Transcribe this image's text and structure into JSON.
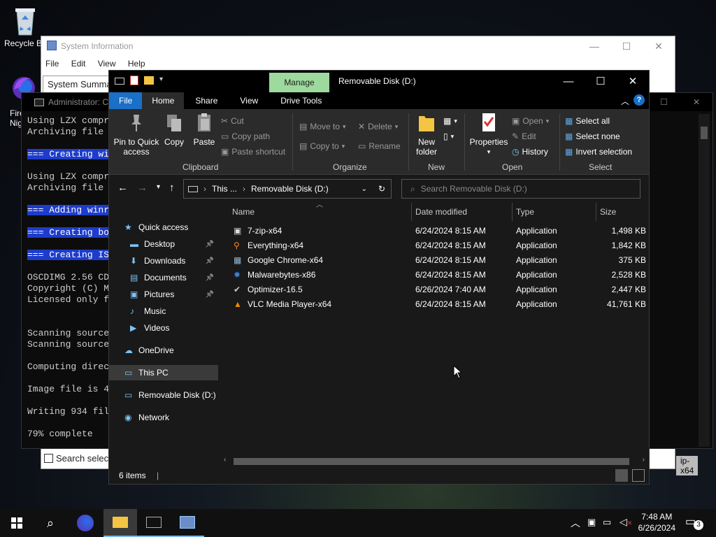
{
  "desktop": {
    "recycle_bin_label": "Recycle B",
    "firefox_label_line1": "Fire",
    "firefox_label_line2": "Nig",
    "side_label": "ip-x64"
  },
  "sysinfo": {
    "title": "System Information",
    "menu": [
      "File",
      "Edit",
      "View",
      "Help"
    ],
    "left_item": "System Summa",
    "search_label": "Search select"
  },
  "console": {
    "title": "Administrator: C",
    "lines": [
      {
        "text": "Using LZX compr",
        "highlight": false
      },
      {
        "text": "Archiving file",
        "highlight": false
      },
      {
        "text": "",
        "highlight": false
      },
      {
        "text": "=== Creating wi",
        "highlight": true
      },
      {
        "text": "",
        "highlight": false
      },
      {
        "text": "Using LZX compr",
        "highlight": false
      },
      {
        "text": "Archiving file",
        "highlight": false
      },
      {
        "text": "",
        "highlight": false
      },
      {
        "text": "=== Adding winr",
        "highlight": true
      },
      {
        "text": "",
        "highlight": false
      },
      {
        "text": "=== Creating bo",
        "highlight": true
      },
      {
        "text": "",
        "highlight": false
      },
      {
        "text": "=== Creating IS",
        "highlight": true
      },
      {
        "text": "",
        "highlight": false
      },
      {
        "text": "OSCDIMG 2.56 CD",
        "highlight": false
      },
      {
        "text": "Copyright (C) M",
        "highlight": false
      },
      {
        "text": "Licensed only f",
        "highlight": false
      },
      {
        "text": "",
        "highlight": false
      },
      {
        "text": "",
        "highlight": false
      },
      {
        "text": "Scanning source",
        "highlight": false
      },
      {
        "text": "Scanning source",
        "highlight": false
      },
      {
        "text": "",
        "highlight": false
      },
      {
        "text": "Computing direc",
        "highlight": false
      },
      {
        "text": "",
        "highlight": false
      },
      {
        "text": "Image file is 4",
        "highlight": false
      },
      {
        "text": "",
        "highlight": false
      },
      {
        "text": "Writing 934 fil",
        "highlight": false
      },
      {
        "text": "",
        "highlight": false
      },
      {
        "text": "79% complete",
        "highlight": false
      }
    ]
  },
  "explorer": {
    "title": "Removable Disk (D:)",
    "manage_tab": "Manage",
    "tabs": [
      "File",
      "Home",
      "Share",
      "View",
      "Drive Tools"
    ],
    "ribbon": {
      "pin": "Pin to Quick\naccess",
      "copy": "Copy",
      "paste": "Paste",
      "cut": "Cut",
      "copy_path": "Copy path",
      "paste_shortcut": "Paste shortcut",
      "clipboard": "Clipboard",
      "move_to": "Move to",
      "copy_to": "Copy to",
      "delete": "Delete",
      "rename": "Rename",
      "organize": "Organize",
      "new_folder": "New\nfolder",
      "new": "New",
      "properties": "Properties",
      "open": "Open",
      "edit": "Edit",
      "history": "History",
      "open_group": "Open",
      "select_all": "Select all",
      "select_none": "Select none",
      "invert_selection": "Invert selection",
      "select": "Select"
    },
    "address": {
      "crumb1": "This ...",
      "crumb2": "Removable Disk (D:)"
    },
    "search_placeholder": "Search Removable Disk (D:)",
    "nav": [
      {
        "label": "Quick access",
        "icon": "star-icon",
        "pinned": false,
        "selected": false
      },
      {
        "label": "Desktop",
        "icon": "desktop-folder-icon",
        "pinned": true,
        "selected": false
      },
      {
        "label": "Downloads",
        "icon": "downloads-folder-icon",
        "pinned": true,
        "selected": false
      },
      {
        "label": "Documents",
        "icon": "documents-folder-icon",
        "pinned": true,
        "selected": false
      },
      {
        "label": "Pictures",
        "icon": "pictures-folder-icon",
        "pinned": true,
        "selected": false
      },
      {
        "label": "Music",
        "icon": "music-icon",
        "pinned": false,
        "selected": false
      },
      {
        "label": "Videos",
        "icon": "videos-icon",
        "pinned": false,
        "selected": false
      },
      {
        "label": "OneDrive",
        "icon": "cloud-icon",
        "pinned": false,
        "selected": false
      },
      {
        "label": "This PC",
        "icon": "computer-icon",
        "pinned": false,
        "selected": true
      },
      {
        "label": "Removable Disk (D:)",
        "icon": "drive-icon",
        "pinned": false,
        "selected": false
      },
      {
        "label": "Network",
        "icon": "network-icon",
        "pinned": false,
        "selected": false
      }
    ],
    "columns": [
      "Name",
      "Date modified",
      "Type",
      "Size"
    ],
    "files": [
      {
        "name": "7-zip-x64",
        "date": "6/24/2024 8:15 AM",
        "type": "Application",
        "size": "1,498 KB",
        "icon": "7zip-icon",
        "color": "#dddddd"
      },
      {
        "name": "Everything-x64",
        "date": "6/24/2024 8:15 AM",
        "type": "Application",
        "size": "1,842 KB",
        "icon": "magnifier-icon",
        "color": "#f08a24"
      },
      {
        "name": "Google Chrome-x64",
        "date": "6/24/2024 8:15 AM",
        "type": "Application",
        "size": "375 KB",
        "icon": "installer-icon",
        "color": "#8fb8d8"
      },
      {
        "name": "Malwarebytes-x86",
        "date": "6/24/2024 8:15 AM",
        "type": "Application",
        "size": "2,528 KB",
        "icon": "malwarebytes-icon",
        "color": "#3c7fd6"
      },
      {
        "name": "Optimizer-16.5",
        "date": "6/26/2024 7:40 AM",
        "type": "Application",
        "size": "2,447 KB",
        "icon": "checkmark-icon",
        "color": "#cccccc"
      },
      {
        "name": "VLC Media Player-x64",
        "date": "6/24/2024 8:15 AM",
        "type": "Application",
        "size": "41,761 KB",
        "icon": "vlc-cone-icon",
        "color": "#f08a00"
      }
    ],
    "status": "6 items"
  },
  "taskbar": {
    "time": "7:48 AM",
    "date": "6/26/2024",
    "notification_count": "3"
  }
}
